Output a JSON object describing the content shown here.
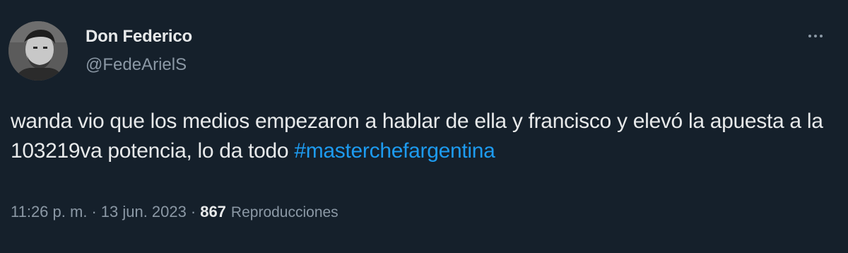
{
  "tweet": {
    "display_name": "Don Federico",
    "handle": "@FedeArielS",
    "text_main": "wanda vio que los medios empezaron a hablar de ella y francisco y elevó la apuesta a la 103219va potencia, lo da todo ",
    "hashtag": "#masterchefargentina",
    "time": "11:26 p. m.",
    "separator": "·",
    "date": "13 jun. 2023",
    "views_count": "867",
    "views_label": "Reproducciones",
    "more_icon": "more-horizontal-icon"
  },
  "colors": {
    "background": "#15202b",
    "text_primary": "#e7e9ea",
    "text_secondary": "#8b98a5",
    "accent": "#1d9bf0"
  }
}
